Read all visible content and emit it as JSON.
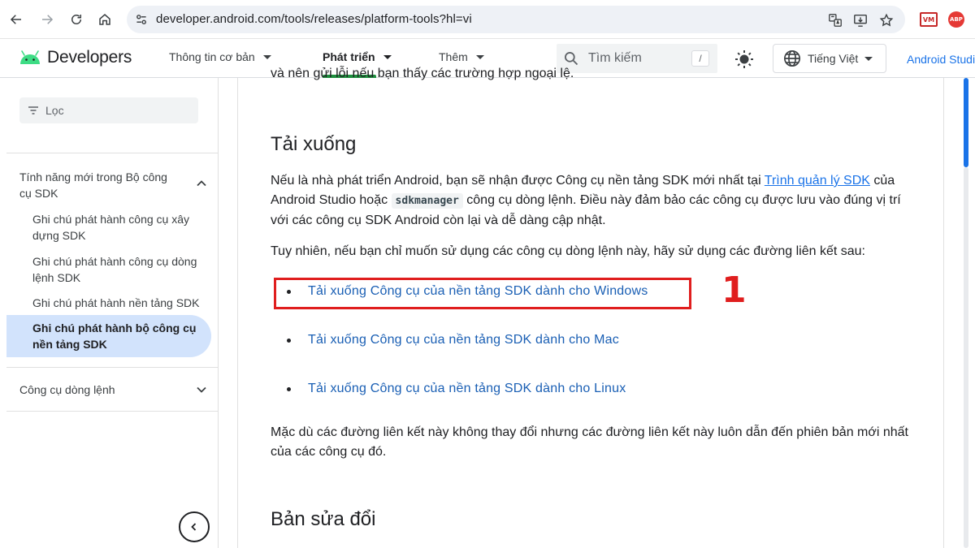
{
  "browser": {
    "url": "developer.android.com/tools/releases/platform-tools?hl=vi",
    "extensions": {
      "vm": "VM",
      "abp": "ABP"
    }
  },
  "header": {
    "logo_text": "Developers",
    "nav": [
      {
        "label": "Thông tin cơ bản"
      },
      {
        "label": "Phát triển"
      },
      {
        "label": "Thêm"
      }
    ],
    "search_placeholder": "Tìm kiếm",
    "search_shortcut": "/",
    "language": "Tiếng Việt",
    "studio_link": "Android Studio"
  },
  "sidebar": {
    "filter_placeholder": "Lọc",
    "group1_title": "Tính năng mới trong Bộ công cụ SDK",
    "items": [
      {
        "label": "Ghi chú phát hành công cụ xây dựng SDK"
      },
      {
        "label": "Ghi chú phát hành công cụ dòng lệnh SDK"
      },
      {
        "label": "Ghi chú phát hành nền tảng SDK"
      },
      {
        "label": "Ghi chú phát hành bộ công cụ nền tảng SDK"
      }
    ],
    "group2_title": "Công cụ dòng lệnh"
  },
  "content": {
    "clipped_text": "và nên gửi lỗi nếu bạn thấy các trường hợp ngoại lệ.",
    "section1_title": "Tải xuống",
    "para1_before_link": "Nếu là nhà phát triển Android, bạn sẽ nhận được Công cụ nền tảng SDK mới nhất tại ",
    "para1_link": "Trình quản lý SDK",
    "para1_after_link": " của Android Studio hoặc ",
    "para1_code": "sdkmanager",
    "para1_end": " công cụ dòng lệnh. Điều này đảm bảo các công cụ được lưu vào đúng vị trí với các công cụ SDK Android còn lại và dễ dàng cập nhật.",
    "para2": "Tuy nhiên, nếu bạn chỉ muốn sử dụng các công cụ dòng lệnh này, hãy sử dụng các đường liên kết sau:",
    "downloads": [
      {
        "label": "Tải xuống Công cụ của nền tảng SDK dành cho Windows"
      },
      {
        "label": "Tải xuống Công cụ của nền tảng SDK dành cho Mac"
      },
      {
        "label": "Tải xuống Công cụ của nền tảng SDK dành cho Linux"
      }
    ],
    "annotation": "1",
    "para3": "Mặc dù các đường liên kết này không thay đổi nhưng các đường liên kết này luôn dẫn đến phiên bản mới nhất của các công cụ đó.",
    "section2_title": "Bản sửa đổi"
  },
  "colors": {
    "link": "#1a73e8",
    "highlight": "#e01e1e",
    "active_item_bg": "#d2e3fc",
    "android_green": "#3ddc84"
  }
}
